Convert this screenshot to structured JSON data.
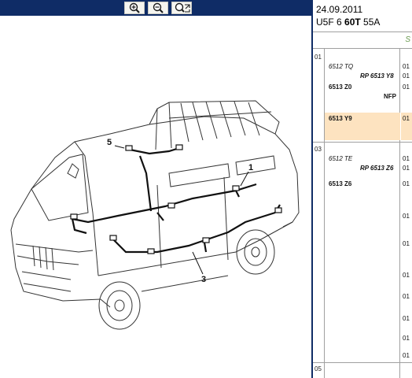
{
  "toolbar": {
    "icons": [
      "zoom-in-icon",
      "zoom-out-icon",
      "zoom-fit-icon"
    ]
  },
  "diagram": {
    "callouts": [
      "1",
      "3",
      "5"
    ]
  },
  "info": {
    "date": "24.09.2011",
    "code_prefix": "U5F 6 ",
    "code_bold": "60T",
    "code_suffix": " 55A",
    "col_head": "S",
    "groups": [
      {
        "num": "01",
        "rows": [
          {
            "ref": "6512 TQ",
            "qty": "01"
          },
          {
            "ref": "RP 6513 Y8",
            "qty": "01"
          },
          {
            "ref": "6513 Z0",
            "qty": "01"
          },
          {
            "ref": "NFP",
            "qty": ""
          },
          {
            "ref": "6513 Y9",
            "qty": "01"
          }
        ]
      },
      {
        "num": "03",
        "rows": [
          {
            "ref": "6512 TE",
            "qty": "01"
          },
          {
            "ref": "RP 6513 Z6",
            "qty": "01"
          },
          {
            "ref": "6513 Z6",
            "qty": "01"
          }
        ]
      },
      {
        "num": "05",
        "rows": []
      }
    ],
    "right_qty": [
      "01",
      "01",
      "01",
      "01",
      "01",
      "01",
      "01"
    ]
  }
}
